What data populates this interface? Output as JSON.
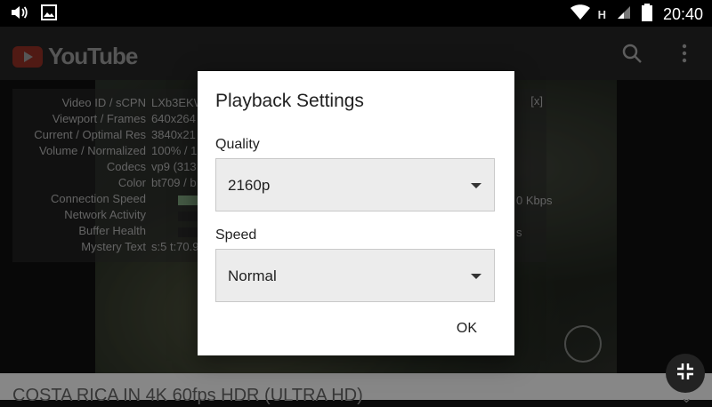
{
  "status_bar": {
    "time": "20:40",
    "network_type": "H"
  },
  "app_bar": {
    "brand": "YouTube"
  },
  "stats": {
    "close_label": "[x]",
    "rows": [
      {
        "label": "Video ID / sCPN",
        "value": "LXb3EKW"
      },
      {
        "label": "Viewport / Frames",
        "value": "640x264"
      },
      {
        "label": "Current / Optimal Res",
        "value": "3840x21"
      },
      {
        "label": "Volume / Normalized",
        "value": "100% / 1"
      },
      {
        "label": "Codecs",
        "value": "vp9 (313"
      },
      {
        "label": "Color",
        "value": "bt709 / b"
      },
      {
        "label": "Connection Speed",
        "value": ""
      },
      {
        "label": "Network Activity",
        "value": ""
      },
      {
        "label": "Buffer Health",
        "value": ""
      },
      {
        "label": "Mystery Text",
        "value": "s:5 t:70.9"
      }
    ],
    "speed_unit_fragment": "0 Kbps",
    "buffer_unit_fragment": "s"
  },
  "video": {
    "title": "COSTA RICA IN 4K 60fps HDR (ULTRA HD)"
  },
  "dialog": {
    "title": "Playback Settings",
    "quality_label": "Quality",
    "quality_value": "2160p",
    "speed_label": "Speed",
    "speed_value": "Normal",
    "ok_label": "OK"
  }
}
